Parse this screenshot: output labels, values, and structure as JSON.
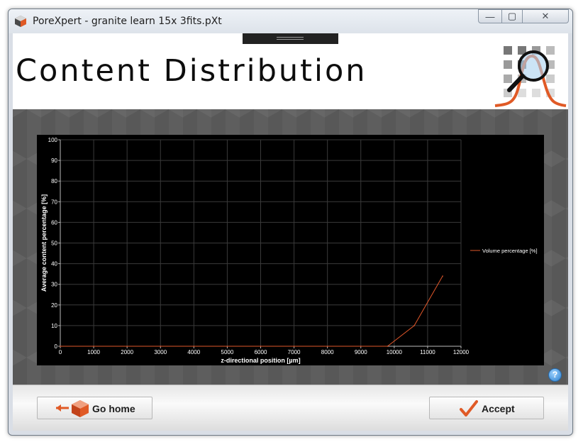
{
  "window": {
    "title": "PoreXpert - granite learn 15x 3fits.pXt",
    "controls": {
      "minimize": "—",
      "maximize": "▢",
      "close": "✕"
    }
  },
  "header": {
    "page_title": "Content Distribution"
  },
  "colors": {
    "accent": "#e05a26",
    "plot_bg": "#000000",
    "grid": "#3a3a3a",
    "line": "#e0572a"
  },
  "chart_data": {
    "type": "line",
    "title": "",
    "xlabel": "z-directional position [µm]",
    "ylabel": "Average content percentage [%]",
    "xlim": [
      0,
      12000
    ],
    "ylim": [
      0,
      100
    ],
    "xticks": [
      0,
      1000,
      2000,
      3000,
      4000,
      5000,
      6000,
      7000,
      8000,
      9000,
      10000,
      11000,
      12000
    ],
    "yticks": [
      0,
      10,
      20,
      30,
      40,
      50,
      60,
      70,
      80,
      90,
      100
    ],
    "grid": true,
    "legend": "right",
    "series": [
      {
        "name": "Volume percentage [%]",
        "color": "#e0572a",
        "x": [
          0,
          1000,
          2000,
          3000,
          4000,
          5000,
          6000,
          7000,
          8000,
          9000,
          9800,
          10600,
          11450
        ],
        "y": [
          0,
          0,
          0,
          0,
          0,
          0,
          0,
          0,
          0,
          0,
          0,
          10,
          34
        ]
      }
    ]
  },
  "help": {
    "label": "?"
  },
  "footer": {
    "home_label": "Go home",
    "accept_label": "Accept"
  }
}
